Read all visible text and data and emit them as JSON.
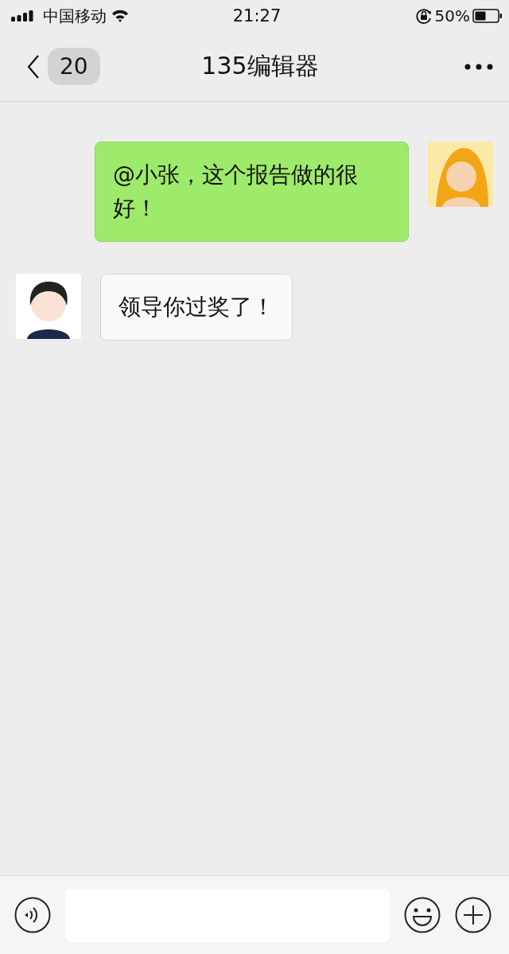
{
  "status_bar": {
    "carrier": "中国移动",
    "time": "21:27",
    "battery": "50%"
  },
  "nav": {
    "unread": "20",
    "title": "135编辑器"
  },
  "messages": [
    {
      "kind": "sent",
      "text": "@小张，这个报告做的很好！"
    },
    {
      "kind": "received",
      "text": "领导你过奖了！"
    }
  ]
}
